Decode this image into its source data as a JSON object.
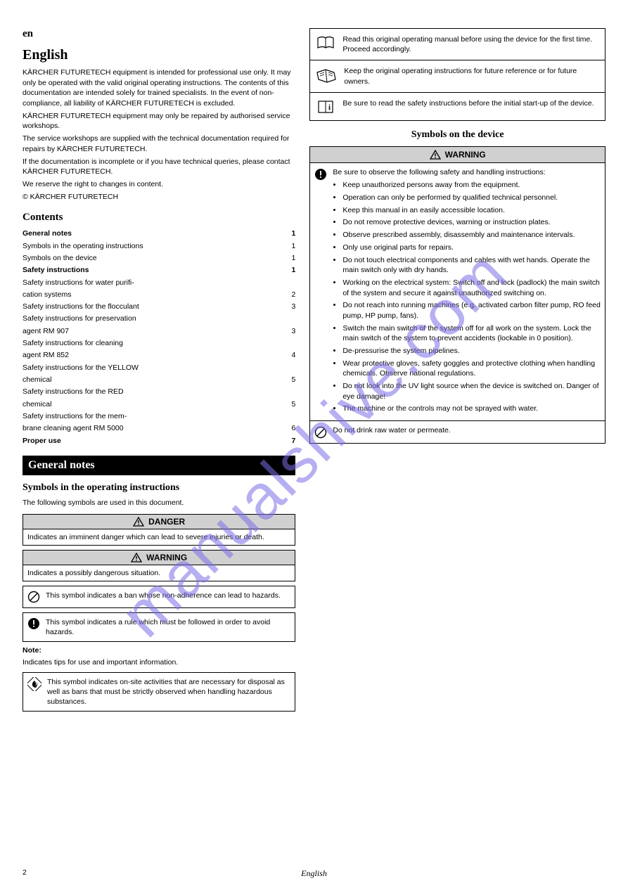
{
  "watermark": "manualshive.com",
  "left": {
    "lang_tag": "en",
    "title": "English",
    "intro": {
      "p1": "KÄRCHER FUTURETECH equipment is intended for professional use only. It may only be operated with the valid original operating instructions. The contents of this documentation are intended solely for trained specialists. In the event of non-compliance, all liability of KÄRCHER FUTURETECH is excluded.",
      "p2": "KÄRCHER FUTURETECH equipment may only be repaired by authorised service workshops.",
      "p3": "The service workshops are supplied with the technical documentation required for repairs by KÄRCHER FUTURETECH.",
      "p4": "If the documentation is incomplete or if you have technical queries, please contact KÄRCHER FUTURETECH.",
      "p5": "We reserve the right to changes in content.",
      "copy": "© KÄRCHER FUTURETECH"
    },
    "toc_title": "Contents",
    "toc": [
      {
        "l": "General notes",
        "r": "1",
        "b": true
      },
      {
        "l": "Symbols in the operating instructions",
        "r": "1"
      },
      {
        "l": "Symbols on the device",
        "r": "1"
      },
      {
        "l": "Safety instructions",
        "r": "1",
        "b": true
      },
      {
        "l": "Safety instructions for water purifi-",
        "r": ""
      },
      {
        "l": "cation systems",
        "r": "2"
      },
      {
        "l": "Safety instructions for the flocculant",
        "r": "3"
      },
      {
        "l": "Safety instructions for preservation",
        "r": ""
      },
      {
        "l": "agent RM 907",
        "r": "3"
      },
      {
        "l": "Safety instructions for cleaning",
        "r": ""
      },
      {
        "l": "agent RM 852",
        "r": "4"
      },
      {
        "l": "Safety instructions for the YELLOW",
        "r": ""
      },
      {
        "l": "chemical",
        "r": "5"
      },
      {
        "l": "Safety instructions for the RED",
        "r": ""
      },
      {
        "l": "chemical",
        "r": "5"
      },
      {
        "l": "Safety instructions for the mem-",
        "r": ""
      },
      {
        "l": "brane cleaning agent RM 5000",
        "r": "6"
      },
      {
        "l": "Proper use",
        "r": "7",
        "b": true
      }
    ],
    "sec_bar": "General notes",
    "sec_sub1": "Symbols in the operating instructions",
    "sub1_text": "The following symbols are used in this document.",
    "danger": {
      "header": "DANGER",
      "body": "Indicates an imminent danger which can lead to severe injuries or death."
    },
    "warning": {
      "header": "WARNING",
      "body": "Indicates a possibly dangerous situation."
    },
    "pic1": "This symbol indicates a ban whose non-adherence can lead to hazards.",
    "pic2": "This symbol indicates a rule which must be followed in order to avoid hazards.",
    "note_label": "Note:",
    "note_text": "Indicates tips for use and important information.",
    "pic3": "This symbol indicates on-site activities that are necessary for disposal as well as bans that must be strictly observed when handling hazardous substances."
  },
  "right": {
    "box1": "Read this original operating manual before using the device for the first time. Proceed accordingly.",
    "box2": "Keep the original operating instructions for future reference or for future owners.",
    "box3": "Be sure to read the safety instructions before the initial start-up of the device.",
    "sec_sub": "Symbols on the device",
    "warning_header": "WARNING",
    "warn_intro": "Be sure to observe the following safety and handling instructions:",
    "bullets": [
      "Keep unauthorized persons away from the equipment.",
      "Operation can only be performed by qualified technical personnel.",
      "Keep this manual in an easily accessible location.",
      "Do not remove protective devices, warning or instruction plates.",
      "Observe prescribed assembly, disassembly and maintenance intervals.",
      "Only use original parts for repairs.",
      "Do not touch electrical components and cables with wet hands. Operate the main switch only with dry hands.",
      "Working on the electrical system: Switch off and lock (padlock) the main switch of the system and secure it against unauthorized switching on.",
      "Do not reach into running machines (e.g. activated carbon filter pump, RO feed pump, HP pump, fans).",
      "Switch the main switch of the system off for all work on the system. Lock the main switch of the system to prevent accidents (lockable in 0 position).",
      "De-pressurise the system pipelines.",
      "Wear protective gloves, safety goggles and protective clothing when handling chemicals. Observe national regulations.",
      "Do not look into the UV light source when the device is switched on. Danger of eye damage!",
      "The machine or the controls may not be sprayed with water."
    ],
    "prohibit": "Do not drink raw water or permeate."
  },
  "footer": {
    "left": "2",
    "mid": "English",
    "right": ""
  }
}
